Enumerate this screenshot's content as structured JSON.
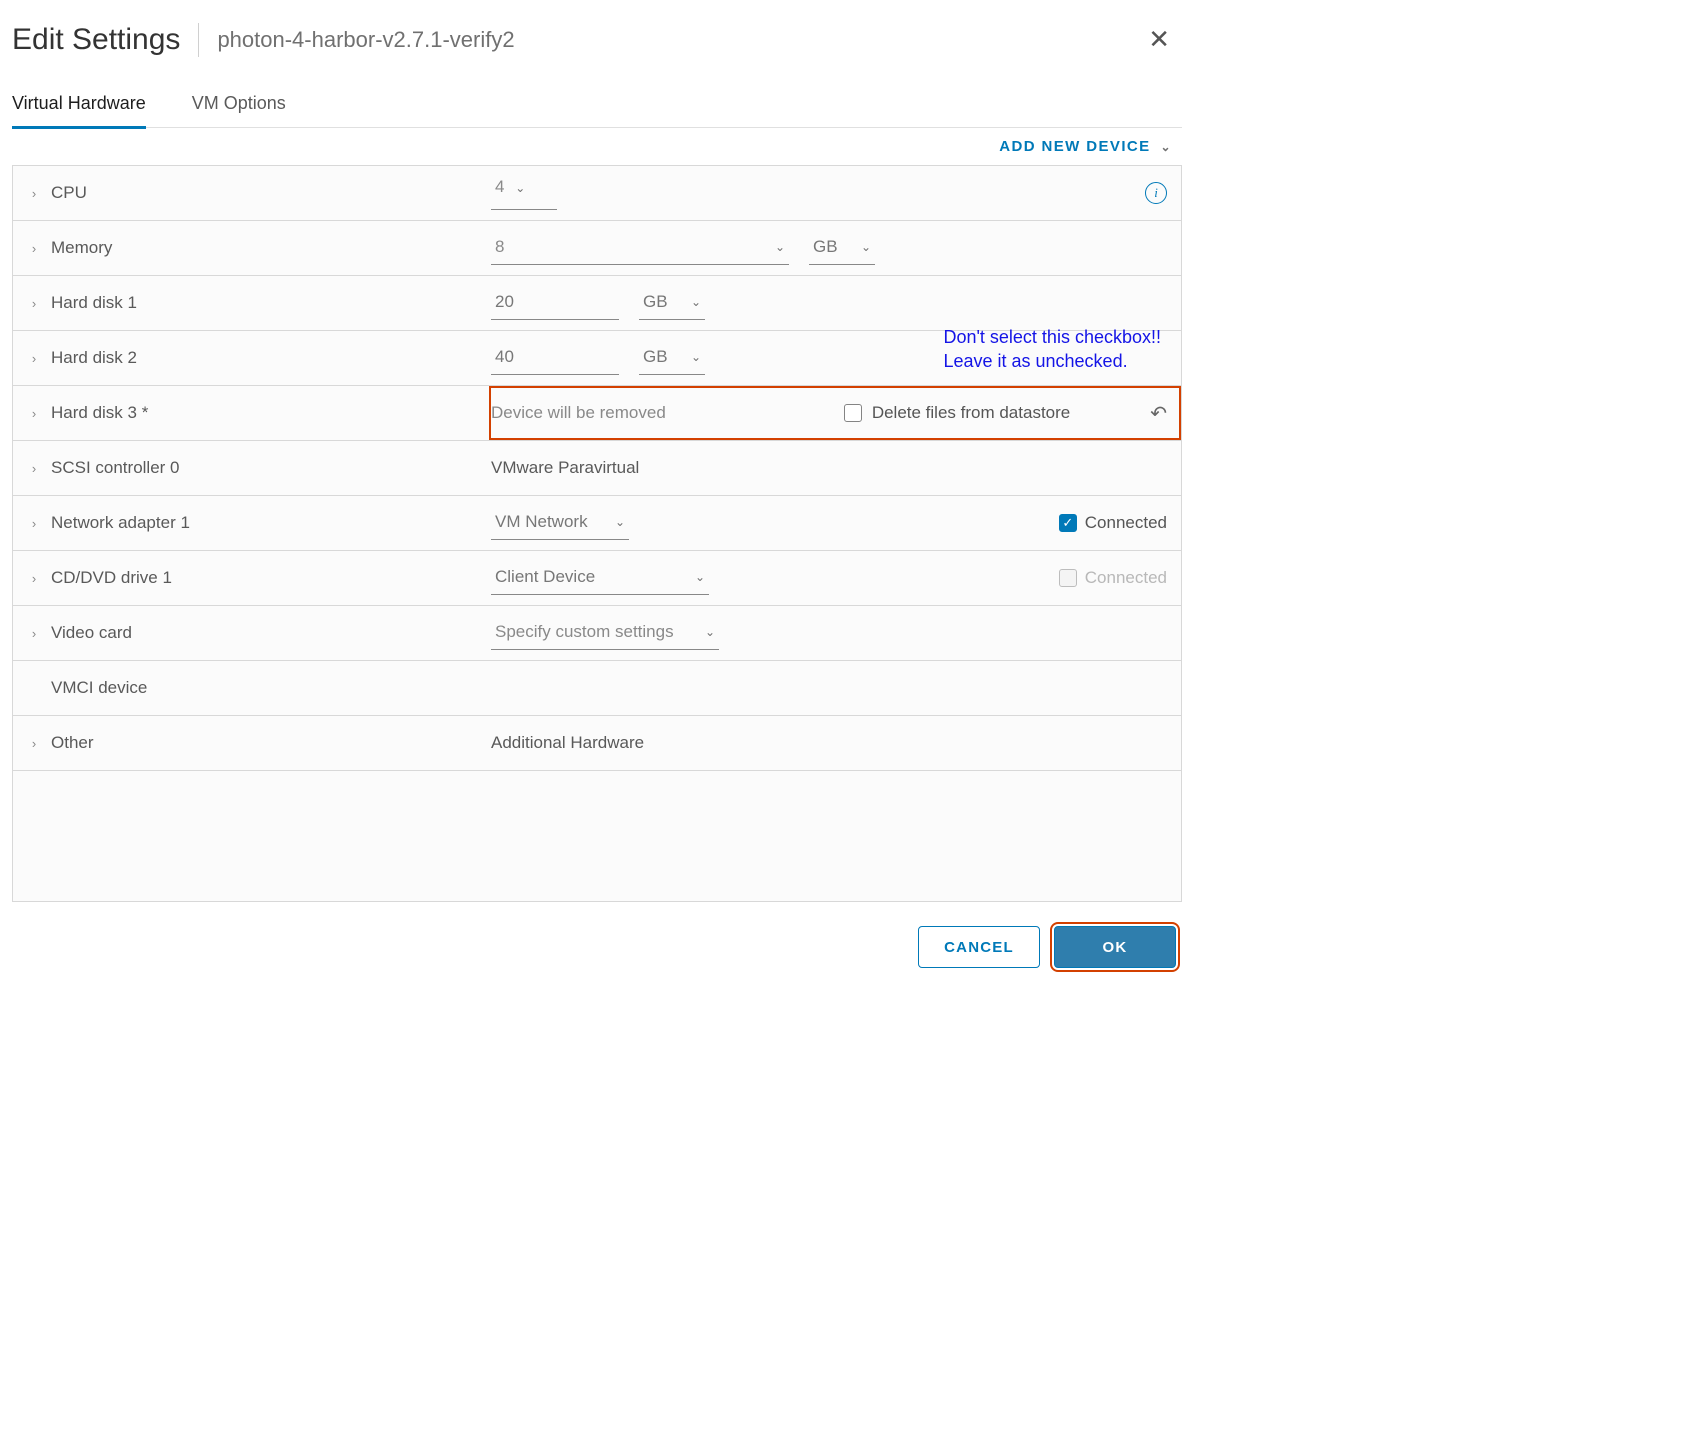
{
  "header": {
    "title": "Edit Settings",
    "subtitle": "photon-4-harbor-v2.7.1-verify2"
  },
  "tabs": {
    "virtual_hardware": "Virtual Hardware",
    "vm_options": "VM Options"
  },
  "add_device": "ADD NEW DEVICE",
  "rows": {
    "cpu": {
      "label": "CPU",
      "value": "4"
    },
    "memory": {
      "label": "Memory",
      "value": "8",
      "unit": "GB"
    },
    "hd1": {
      "label": "Hard disk 1",
      "value": "20",
      "unit": "GB"
    },
    "hd2": {
      "label": "Hard disk 2",
      "value": "40",
      "unit": "GB"
    },
    "hd3": {
      "label": "Hard disk 3 *",
      "note": "Device will be removed",
      "delete_label": "Delete files from datastore"
    },
    "scsi": {
      "label": "SCSI controller 0",
      "value": "VMware Paravirtual"
    },
    "net": {
      "label": "Network adapter 1",
      "value": "VM Network",
      "connected": "Connected"
    },
    "cd": {
      "label": "CD/DVD drive 1",
      "value": "Client Device",
      "connected": "Connected"
    },
    "video": {
      "label": "Video card",
      "value": "Specify custom settings"
    },
    "vmci": {
      "label": "VMCI device"
    },
    "other": {
      "label": "Other",
      "value": "Additional Hardware"
    }
  },
  "annotation": {
    "line1": "Don't select this checkbox!!",
    "line2": "Leave it as unchecked."
  },
  "footer": {
    "cancel": "CANCEL",
    "ok": "OK"
  }
}
